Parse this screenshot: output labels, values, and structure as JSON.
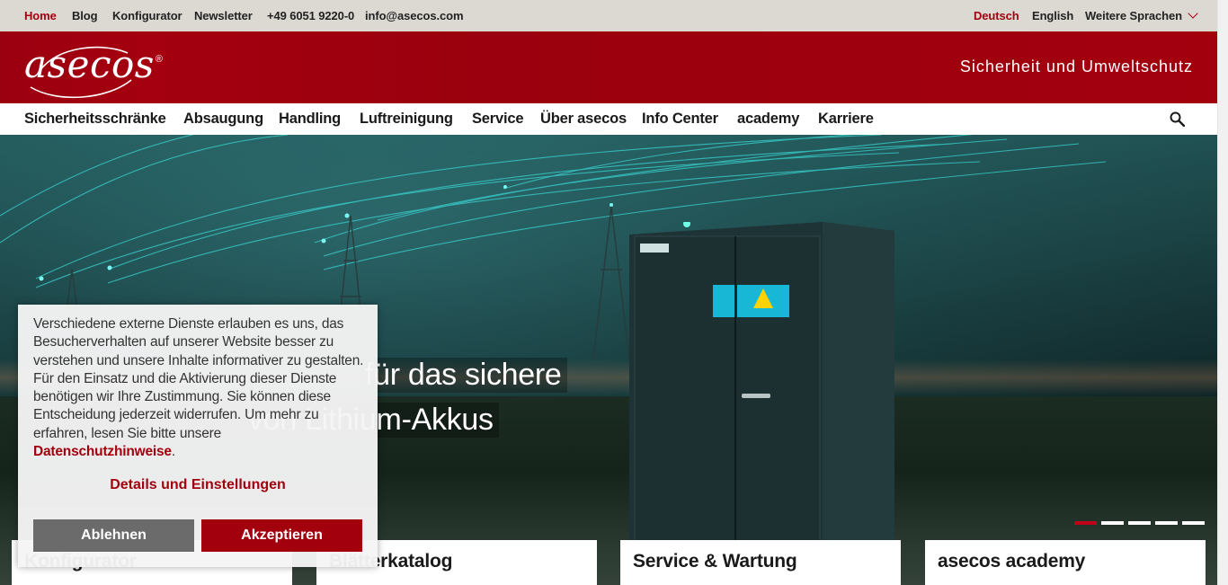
{
  "topbar": {
    "links": [
      "Home",
      "Blog",
      "Konfigurator",
      "Newsletter",
      "+49 6051 9220-0",
      "info@asecos.com"
    ],
    "languages": [
      "Deutsch",
      "English"
    ],
    "more_languages": "Weitere Sprachen"
  },
  "header": {
    "logo_text": "asecos",
    "logo_mark": "®",
    "tagline": "Sicherheit und Umweltschutz"
  },
  "nav": {
    "items": [
      "Sicherheitsschränke",
      "Absaugung",
      "Handling",
      "Luftreinigung",
      "Service",
      "Über asecos",
      "Info Center",
      "academy",
      "Karriere"
    ]
  },
  "hero": {
    "headline_line1": "für das sichere",
    "headline_line2": "von Lithium-Akkus",
    "slide_count": 5,
    "active_slide": 1
  },
  "cards": [
    "Konfigurator",
    "Blätterkatalog",
    "Service & Wartung",
    "asecos academy"
  ],
  "cookie": {
    "text": "Verschiedene externe Dienste erlauben es uns, das Besucherverhalten auf unserer Website besser zu verstehen und unsere Inhalte informativer zu gestalten. Für den Einsatz und die Aktivierung dieser Dienste benötigen wir Ihre Zustimmung. Sie können diese Entscheidung jederzeit widerrufen. Um mehr zu erfahren, lesen Sie bitte unsere",
    "privacy_link": "Datenschutzhinweise",
    "period": ".",
    "details_link": "Details und Einstellungen",
    "decline_label": "Ablehnen",
    "accept_label": "Akzeptieren"
  },
  "colors": {
    "brand_red": "#a3000e",
    "topbar_bg": "#dcd9d3",
    "decline_gray": "#6b6b6b"
  }
}
